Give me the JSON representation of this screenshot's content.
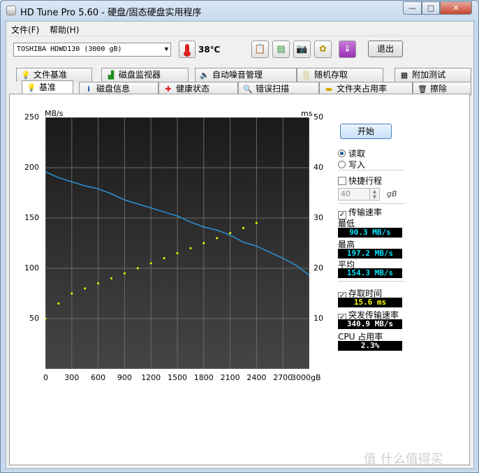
{
  "window": {
    "title": "HD Tune Pro 5.60 - 硬盘/固态硬盘实用程序",
    "min_label": "—",
    "max_label": "□",
    "close_label": "✕"
  },
  "menu": [
    "文件(F)",
    "帮助(H)"
  ],
  "toolbar": {
    "drive": "TOSHIBA HDWD130 (3000 gB)",
    "temperature": "38℃",
    "exit_label": "退出",
    "icons": [
      "copy-text-icon",
      "copy-screenshot-icon",
      "camera-icon",
      "options-icon",
      "save-icon"
    ]
  },
  "tabs_row1": [
    "文件基准",
    "磁盘监视器",
    "自动噪音管理",
    "随机存取",
    "附加测试"
  ],
  "tabs_row2": [
    "基准",
    "磁盘信息",
    "健康状态",
    "错误扫描",
    "文件夹占用率",
    "擦除"
  ],
  "chart": {
    "left_unit": "MB/s",
    "right_unit": "ms",
    "left_ticks": [
      "250",
      "200",
      "150",
      "100",
      "50"
    ],
    "right_ticks": [
      "50",
      "40",
      "30",
      "20",
      "10"
    ],
    "x_ticks": [
      "0",
      "300",
      "600",
      "900",
      "1200",
      "1500",
      "1800",
      "2100",
      "2400",
      "2700",
      "3000gB"
    ]
  },
  "chart_data": {
    "type": "line",
    "title": "",
    "xlabel": "",
    "ylabel": "MB/s",
    "y2label": "ms",
    "xlim": [
      0,
      3000
    ],
    "ylim": [
      0,
      250
    ],
    "y2lim": [
      0,
      50
    ],
    "grid": true,
    "series": [
      {
        "name": "传输速率",
        "axis": "left",
        "color": "#2b9be6",
        "x": [
          0,
          150,
          300,
          450,
          600,
          750,
          900,
          1050,
          1200,
          1350,
          1500,
          1650,
          1800,
          1950,
          2100,
          2250,
          2400,
          2550,
          2700,
          2850,
          3000
        ],
        "y": [
          196,
          190,
          186,
          182,
          179,
          174,
          168,
          164,
          160,
          156,
          152,
          146,
          141,
          138,
          133,
          126,
          122,
          116,
          110,
          103,
          93
        ]
      },
      {
        "name": "存取时间",
        "axis": "right",
        "type": "scatter",
        "color": "#e4e800",
        "x": [
          0,
          150,
          300,
          450,
          600,
          750,
          900,
          1050,
          1200,
          1350,
          1500,
          1650,
          1800,
          1950,
          2100,
          2250,
          2400
        ],
        "y": [
          10,
          13,
          15,
          16,
          17,
          18,
          19,
          20,
          21,
          22,
          23,
          24,
          25,
          26,
          27,
          28,
          29
        ]
      }
    ]
  },
  "side": {
    "start_label": "开始",
    "read_label": "读取",
    "write_label": "写入",
    "short_stroke_label": "快捷行程",
    "short_stroke_value": "40",
    "short_stroke_unit": "gB",
    "transfer_rate_label": "传输速率",
    "min_label": "最低",
    "min_value": "90.3 MB/s",
    "max_label": "最高",
    "max_value": "197.2 MB/s",
    "avg_label": "平均",
    "avg_value": "154.3 MB/s",
    "access_time_label": "存取时间",
    "access_time_value": "15.6 ms",
    "burst_label": "突发传输速率",
    "burst_value": "340.9 MB/s",
    "cpu_label": "CPU 占用率",
    "cpu_value": "2.3%"
  },
  "watermark": "值 什么值得买"
}
